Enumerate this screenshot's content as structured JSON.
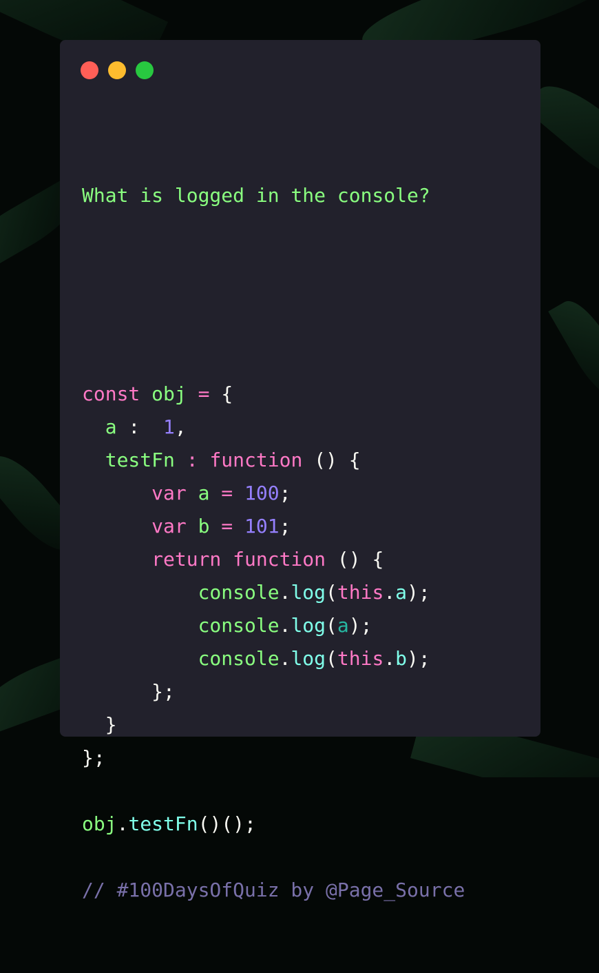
{
  "window": {
    "controls": [
      {
        "name": "close",
        "color": "#ff5f57"
      },
      {
        "name": "minimize",
        "color": "#febc2e"
      },
      {
        "name": "zoom",
        "color": "#28c840"
      }
    ],
    "background_color": "#22212c"
  },
  "colors": {
    "keyword": "#ff79c6",
    "identifier": "#8aff80",
    "number": "#9580ff",
    "function_call": "#80ffea",
    "punctuation": "#f8f8f2",
    "comment": "#7970a9"
  },
  "code": {
    "question": "What is logged in the console?",
    "lines": [
      [
        {
          "t": "const",
          "c": "kw"
        },
        {
          "t": " ",
          "c": "wht"
        },
        {
          "t": "obj",
          "c": "grn"
        },
        {
          "t": " = ",
          "c": "kw"
        },
        {
          "t": "{",
          "c": "wht"
        }
      ],
      [
        {
          "t": "  a",
          "c": "grn"
        },
        {
          "t": " :  ",
          "c": "wht"
        },
        {
          "t": "1",
          "c": "num"
        },
        {
          "t": ",",
          "c": "wht"
        }
      ],
      [
        {
          "t": "  testFn",
          "c": "grn"
        },
        {
          "t": " : ",
          "c": "kw"
        },
        {
          "t": "function",
          "c": "kw"
        },
        {
          "t": " () {",
          "c": "wht"
        }
      ],
      [
        {
          "t": "      var",
          "c": "kw"
        },
        {
          "t": " a",
          "c": "grn"
        },
        {
          "t": " = ",
          "c": "kw"
        },
        {
          "t": "100",
          "c": "num"
        },
        {
          "t": ";",
          "c": "wht"
        }
      ],
      [
        {
          "t": "      var",
          "c": "kw"
        },
        {
          "t": " b",
          "c": "grn"
        },
        {
          "t": " = ",
          "c": "kw"
        },
        {
          "t": "101",
          "c": "num"
        },
        {
          "t": ";",
          "c": "wht"
        }
      ],
      [
        {
          "t": "      return function",
          "c": "kw"
        },
        {
          "t": " () {",
          "c": "wht"
        }
      ],
      [
        {
          "t": "          console",
          "c": "grn"
        },
        {
          "t": ".",
          "c": "wht"
        },
        {
          "t": "log",
          "c": "cyan"
        },
        {
          "t": "(",
          "c": "wht"
        },
        {
          "t": "this",
          "c": "kw"
        },
        {
          "t": ".",
          "c": "wht"
        },
        {
          "t": "a",
          "c": "cyan"
        },
        {
          "t": ");",
          "c": "wht"
        }
      ],
      [
        {
          "t": "          console",
          "c": "grn"
        },
        {
          "t": ".",
          "c": "wht"
        },
        {
          "t": "log",
          "c": "cyan"
        },
        {
          "t": "(",
          "c": "wht"
        },
        {
          "t": "a",
          "c": "teal"
        },
        {
          "t": ");",
          "c": "wht"
        }
      ],
      [
        {
          "t": "          console",
          "c": "grn"
        },
        {
          "t": ".",
          "c": "wht"
        },
        {
          "t": "log",
          "c": "cyan"
        },
        {
          "t": "(",
          "c": "wht"
        },
        {
          "t": "this",
          "c": "kw"
        },
        {
          "t": ".",
          "c": "wht"
        },
        {
          "t": "b",
          "c": "cyan"
        },
        {
          "t": ");",
          "c": "wht"
        }
      ],
      [
        {
          "t": "      };",
          "c": "wht"
        }
      ],
      [
        {
          "t": "  }",
          "c": "wht"
        }
      ],
      [
        {
          "t": "};",
          "c": "wht"
        }
      ],
      [],
      [
        {
          "t": "obj",
          "c": "grn"
        },
        {
          "t": ".",
          "c": "wht"
        },
        {
          "t": "testFn",
          "c": "cyan"
        },
        {
          "t": "()();",
          "c": "wht"
        }
      ],
      [],
      [
        {
          "t": "// #100DaysOfQuiz by @Page_Source",
          "c": "cmt"
        }
      ]
    ]
  }
}
